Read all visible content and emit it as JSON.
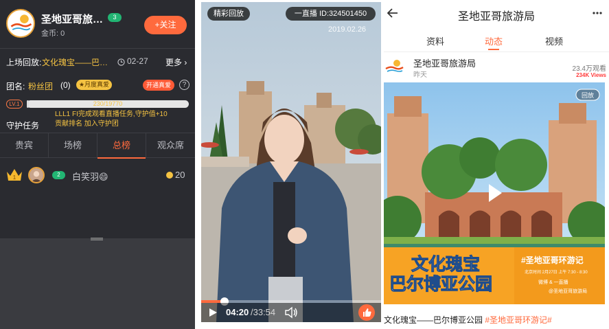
{
  "host": {
    "name": "圣地亚哥旅…",
    "level": "3",
    "coins": "金币: 0",
    "follow_label": "+关注",
    "logo_text": "San Diego"
  },
  "replay": {
    "prefix": "上场回放:",
    "title": "文化瑰宝——巴…",
    "date": "02-27",
    "more": "更多"
  },
  "fan_club": {
    "label": "团名:",
    "name": "粉丝团",
    "count": "(0)",
    "badge": "★月度真爱",
    "open_button": "开通真爱",
    "help": "?"
  },
  "level": {
    "badge": "LV.1",
    "progress_text": "230/19770",
    "progress": 0.0116
  },
  "guard": {
    "label": "守护任务",
    "lines": [
      "LLL1 FI完成观看直播任务,守护值+10",
      "贡献排名 加入守护团"
    ]
  },
  "rank_tabs": [
    {
      "label": "贵宾"
    },
    {
      "label": "场榜"
    },
    {
      "label": "总榜"
    },
    {
      "label": "观众席"
    }
  ],
  "rank_entries": [
    {
      "rank": "1",
      "level": "2",
      "name": "白笑羽😄",
      "score": "20"
    }
  ],
  "video": {
    "replay_badge": "精彩回放",
    "live_id": "一直播 ID:324501450",
    "date": "2019.02.26",
    "time_current": "04:20",
    "time_total": "/33:54",
    "progress": 0.128
  },
  "mobile": {
    "title": "圣地亚哥旅游局",
    "tabs": [
      {
        "label": "资料"
      },
      {
        "label": "动态"
      },
      {
        "label": "视频"
      }
    ],
    "post": {
      "author": "圣地亚哥旅游局",
      "time": "昨天",
      "views": "23.4万观看",
      "views_en": "234K Views",
      "image_badge": "回放",
      "overlay_title_line1": "文化瑰宝",
      "overlay_title_line2": "巴尔博亚公园",
      "overlay_hashtag": "#圣地亚哥环游记",
      "overlay_time": "北京时间 2月27日 上午 7:30 - 8:30",
      "overlay_platforms": "微博 & 一直播",
      "overlay_account": "@圣地亚哥旅游局",
      "caption": "文化瑰宝——巴尔博亚公园 ",
      "caption_hashtag": "#圣地亚哥环游记#"
    }
  },
  "colors": {
    "accent": "#ff6a3d",
    "gold": "#f5c342",
    "green": "#22b573",
    "panel_dark": "#2a2b30"
  }
}
